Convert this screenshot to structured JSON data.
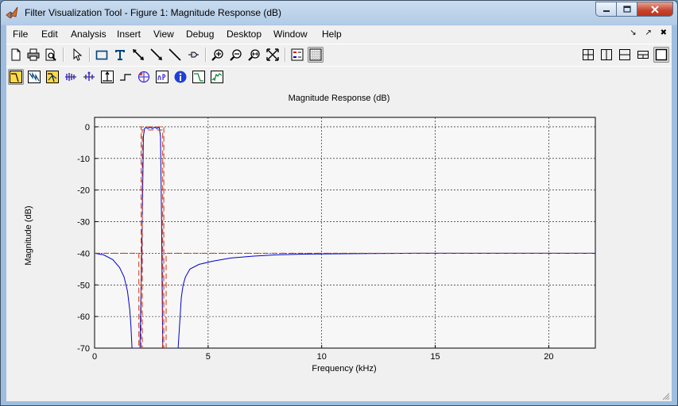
{
  "window": {
    "title": "Filter Visualization Tool - Figure 1: Magnitude Response (dB)",
    "controls": [
      "minimize",
      "maximize",
      "close"
    ]
  },
  "menu": {
    "items": [
      "File",
      "Edit",
      "Analysis",
      "Insert",
      "View",
      "Debug",
      "Desktop",
      "Window",
      "Help"
    ]
  },
  "toolbar": {
    "row1": [
      "new-figure-icon",
      "print-icon",
      "print-preview-icon",
      "select-arrow-icon",
      "rectangle-icon",
      "text-icon",
      "double-arrow-icon",
      "arrow-icon",
      "line-icon",
      "pin-icon",
      "zoom-in-icon",
      "zoom-out-icon",
      "zoom-x-icon",
      "full-view-icon",
      "legend-icon",
      "grid-icon"
    ],
    "row1_right": [
      "tile-layout-icon",
      "left-right-layout-icon",
      "top-bottom-layout-icon",
      "dock-layout-icon",
      "maximize-layout-icon"
    ],
    "row2": [
      "magnitude-response-icon",
      "phase-response-icon",
      "magnitude-phase-icon",
      "group-delay-icon",
      "phase-delay-icon",
      "impulse-response-icon",
      "step-response-icon",
      "pole-zero-icon",
      "coefficients-icon",
      "info-icon",
      "magnitude-estimate-icon",
      "round-off-noise-icon"
    ]
  },
  "plot": {
    "title": "Magnitude Response (dB)",
    "xlabel": "Frequency (kHz)",
    "ylabel": "Magnitude (dB)"
  },
  "chart_data": {
    "type": "line",
    "title": "Magnitude Response (dB)",
    "xlabel": "Frequency (kHz)",
    "ylabel": "Magnitude (dB)",
    "xlim": [
      0,
      22.05
    ],
    "ylim": [
      -70,
      3
    ],
    "xticks": [
      0,
      5,
      10,
      15,
      20
    ],
    "yticks": [
      0,
      -10,
      -20,
      -30,
      -40,
      -50,
      -60,
      -70
    ],
    "grid": true,
    "colors": {
      "response": "#0000cc",
      "mask": "#cc3311"
    },
    "series": [
      {
        "style": "solid",
        "x": [
          0,
          0.4,
          0.8,
          1.1,
          1.3,
          1.45,
          1.55,
          1.6,
          1.65,
          1.72,
          1.8,
          1.9,
          2.0,
          2.1,
          2.15,
          2.2,
          2.25,
          2.35,
          2.45,
          2.55,
          2.65,
          2.75,
          2.8,
          2.85,
          2.9,
          2.95,
          3.0,
          3.05,
          3.12,
          3.2,
          3.3,
          3.45,
          3.6,
          3.68,
          3.75,
          3.82,
          3.9,
          4.0,
          4.2,
          4.6,
          5.2,
          6,
          7,
          8,
          9,
          10,
          12,
          14,
          16,
          18,
          20,
          22.05
        ],
        "y": [
          -40,
          -40.5,
          -42,
          -44.5,
          -47.5,
          -52,
          -58,
          -63,
          -70,
          -70,
          -70,
          -70,
          -70,
          -30,
          -3,
          -0.5,
          -0.2,
          -0.5,
          -0.1,
          -0.5,
          -0.1,
          -0.5,
          -0.2,
          -0.3,
          -3,
          -30,
          -70,
          -70,
          -70,
          -70,
          -70,
          -70,
          -70,
          -70,
          -62,
          -54,
          -50,
          -47.5,
          -45,
          -43.5,
          -42.5,
          -41.5,
          -40.9,
          -40.5,
          -40.3,
          -40.2,
          -40.1,
          -40,
          -40,
          -40,
          -40,
          -40
        ]
      },
      {
        "style": "dashed",
        "x": [
          0,
          1.95,
          1.95,
          2.1,
          2.1,
          3.0,
          3.0,
          3.15,
          3.15,
          22.05
        ],
        "y": [
          -40,
          -40,
          -70,
          -70,
          -1,
          -1,
          -70,
          -70,
          -40,
          -40
        ]
      },
      {
        "style": "dashed",
        "x": [
          2.05,
          2.05,
          3.05,
          3.05
        ],
        "y": [
          -70,
          0,
          0,
          -70
        ]
      }
    ]
  }
}
